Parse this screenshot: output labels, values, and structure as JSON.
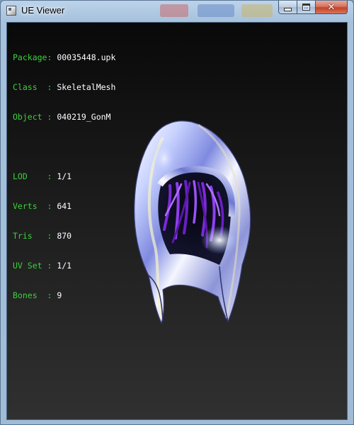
{
  "window": {
    "title": "UE Viewer",
    "controls": {
      "minimize": "minimize",
      "maximize": "maximize",
      "close": "close"
    }
  },
  "info_panel": {
    "group1": [
      {
        "label": "Package: ",
        "value": "00035448.upk"
      },
      {
        "label": "Class  : ",
        "value": "SkeletalMesh"
      },
      {
        "label": "Object : ",
        "value": "040219_GonM"
      }
    ],
    "group2": [
      {
        "label": "LOD    : ",
        "value": "1/1"
      },
      {
        "label": "Verts  : ",
        "value": "641"
      },
      {
        "label": "Tris   : ",
        "value": "870"
      },
      {
        "label": "UV Set : ",
        "value": "1/1"
      },
      {
        "label": "Bones  : ",
        "value": "9"
      }
    ]
  },
  "colors": {
    "label": "#3ad13a",
    "value": "#ffffff",
    "viewport_top": "#090909",
    "viewport_bottom": "#303030"
  },
  "model": {
    "name": "hood-mesh",
    "hair_color": "#7a2ad8"
  }
}
